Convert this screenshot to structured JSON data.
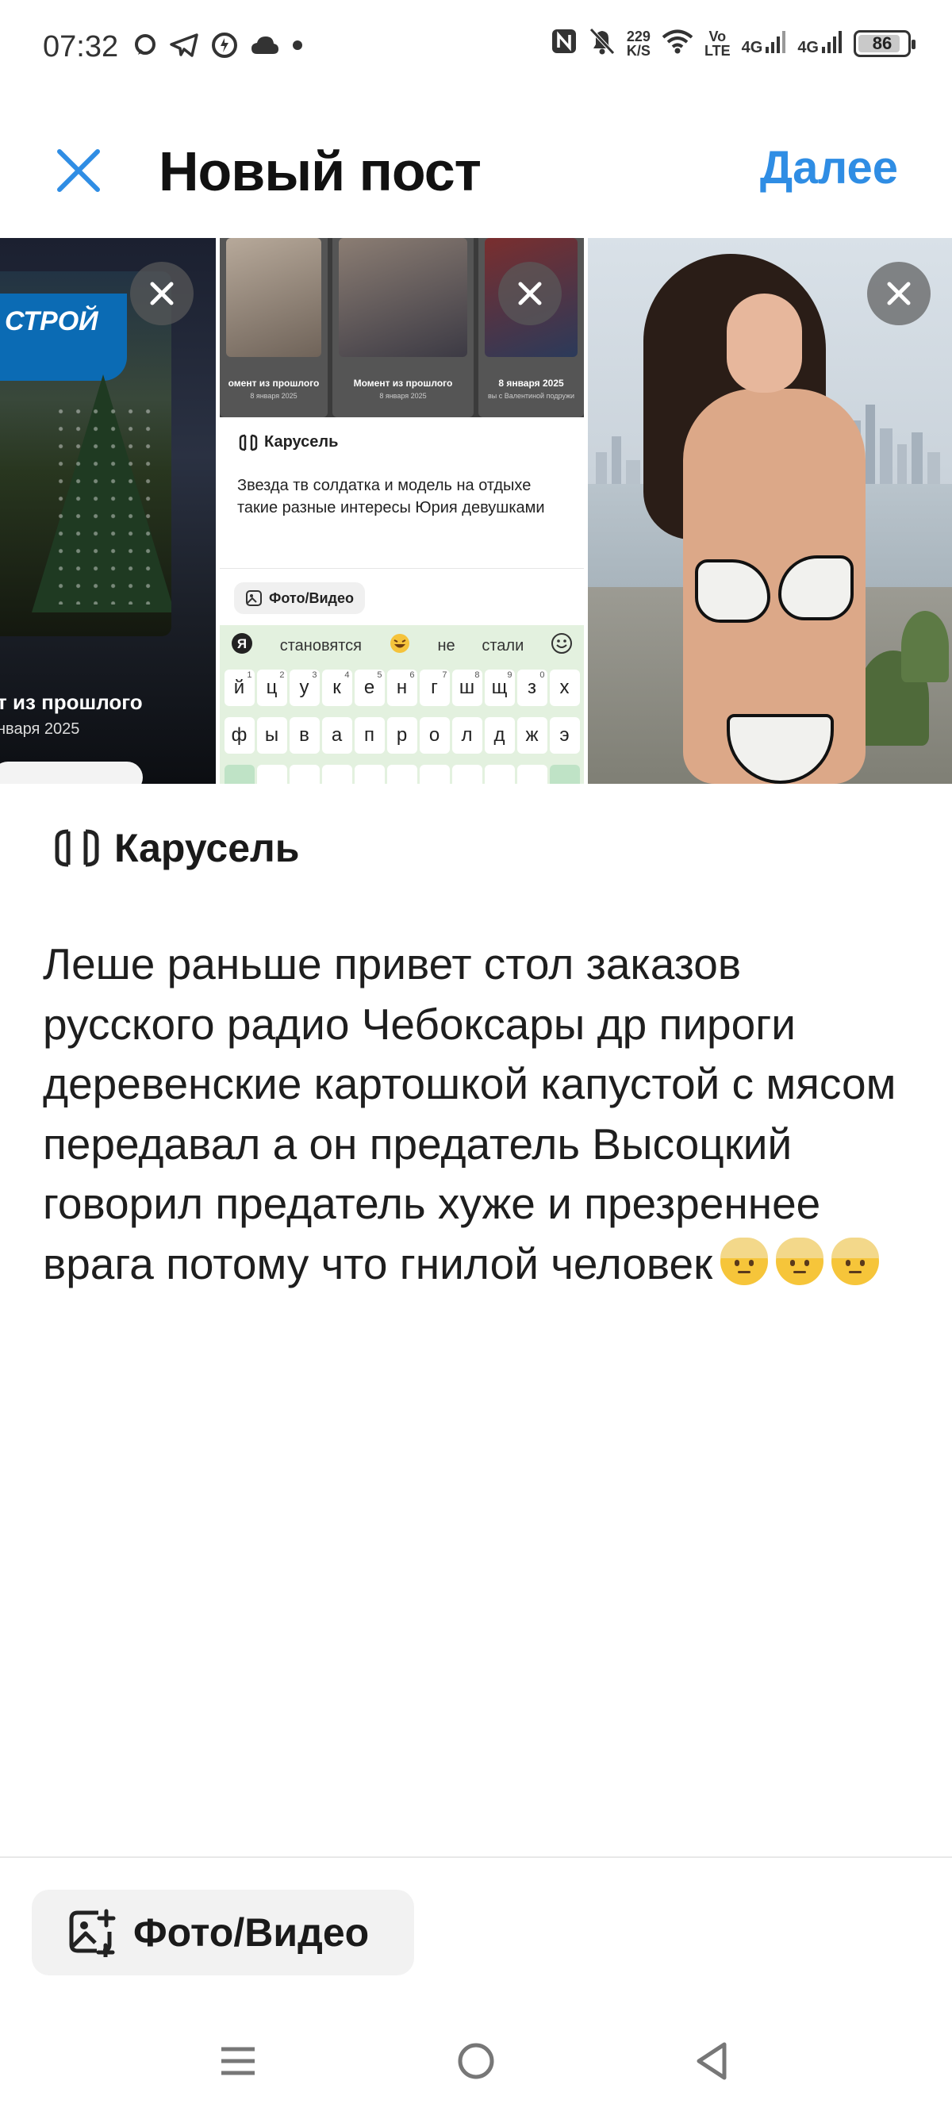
{
  "status_bar": {
    "time": "07:32",
    "net_speed_value": "229",
    "net_speed_unit": "K/S",
    "volte_top": "Vo",
    "volte_bottom": "LTE",
    "sim1": "4G",
    "sim2": "4G",
    "battery": "86",
    "battery_level": 0.86,
    "icons": [
      "chat-bubble-icon",
      "telegram-icon",
      "sync-icon",
      "cloud-icon",
      "dot-icon",
      "nfc-icon",
      "bell-off-icon",
      "wifi-icon",
      "signal-icon",
      "signal-icon",
      "battery-icon"
    ]
  },
  "header": {
    "close_icon": "close-icon",
    "title": "Новый пост",
    "next_label": "Далее",
    "accent_color": "#2f8de4"
  },
  "media": {
    "thumb1": {
      "sign_text": "СТРОЙ",
      "caption_title": "т из прошлого",
      "caption_date": "нваря 2025"
    },
    "thumb2": {
      "mini": [
        {
          "caption": "омент из прошлого",
          "date": "8 января 2025"
        },
        {
          "caption": "Момент из прошлого",
          "date": "8 января 2025"
        },
        {
          "caption": "8 января 2025",
          "date": "вы с Валентиной подружи"
        }
      ],
      "carousel_label": "Карусель",
      "post_text": "Звезда тв солдатка и модель на отдыхе такие разные интересы Юрия девушками",
      "photo_chip": "Фото/Видео",
      "suggestions": [
        "становятся",
        "не",
        "стали"
      ],
      "row1": [
        {
          "k": "й",
          "n": "1"
        },
        {
          "k": "ц",
          "n": "2"
        },
        {
          "k": "у",
          "n": "3"
        },
        {
          "k": "к",
          "n": "4"
        },
        {
          "k": "е",
          "n": "5"
        },
        {
          "k": "н",
          "n": "6"
        },
        {
          "k": "г",
          "n": "7"
        },
        {
          "k": "ш",
          "n": "8"
        },
        {
          "k": "щ",
          "n": "9"
        },
        {
          "k": "з",
          "n": "0"
        },
        {
          "k": "х",
          "n": ""
        }
      ],
      "row2": [
        "ф",
        "ы",
        "в",
        "а",
        "п",
        "р",
        "о",
        "л",
        "д",
        "ж",
        "э"
      ]
    }
  },
  "carousel": {
    "icon": "carousel-icon",
    "label": "Карусель"
  },
  "post": {
    "text": "Леше раньше привет стол заказов русского радио Чебоксары др пироги деревенские картошкой капустой с мясом передавал а он предатель Высоцкий говорил предатель хуже и презреннее врага потому что гнилой человек",
    "emoji_count": 3
  },
  "bottom": {
    "media_icon": "add-photo-icon",
    "media_label": "Фото/Видео"
  },
  "navbar": {
    "icons": [
      "menu-icon",
      "home-circle-icon",
      "back-triangle-icon"
    ]
  }
}
